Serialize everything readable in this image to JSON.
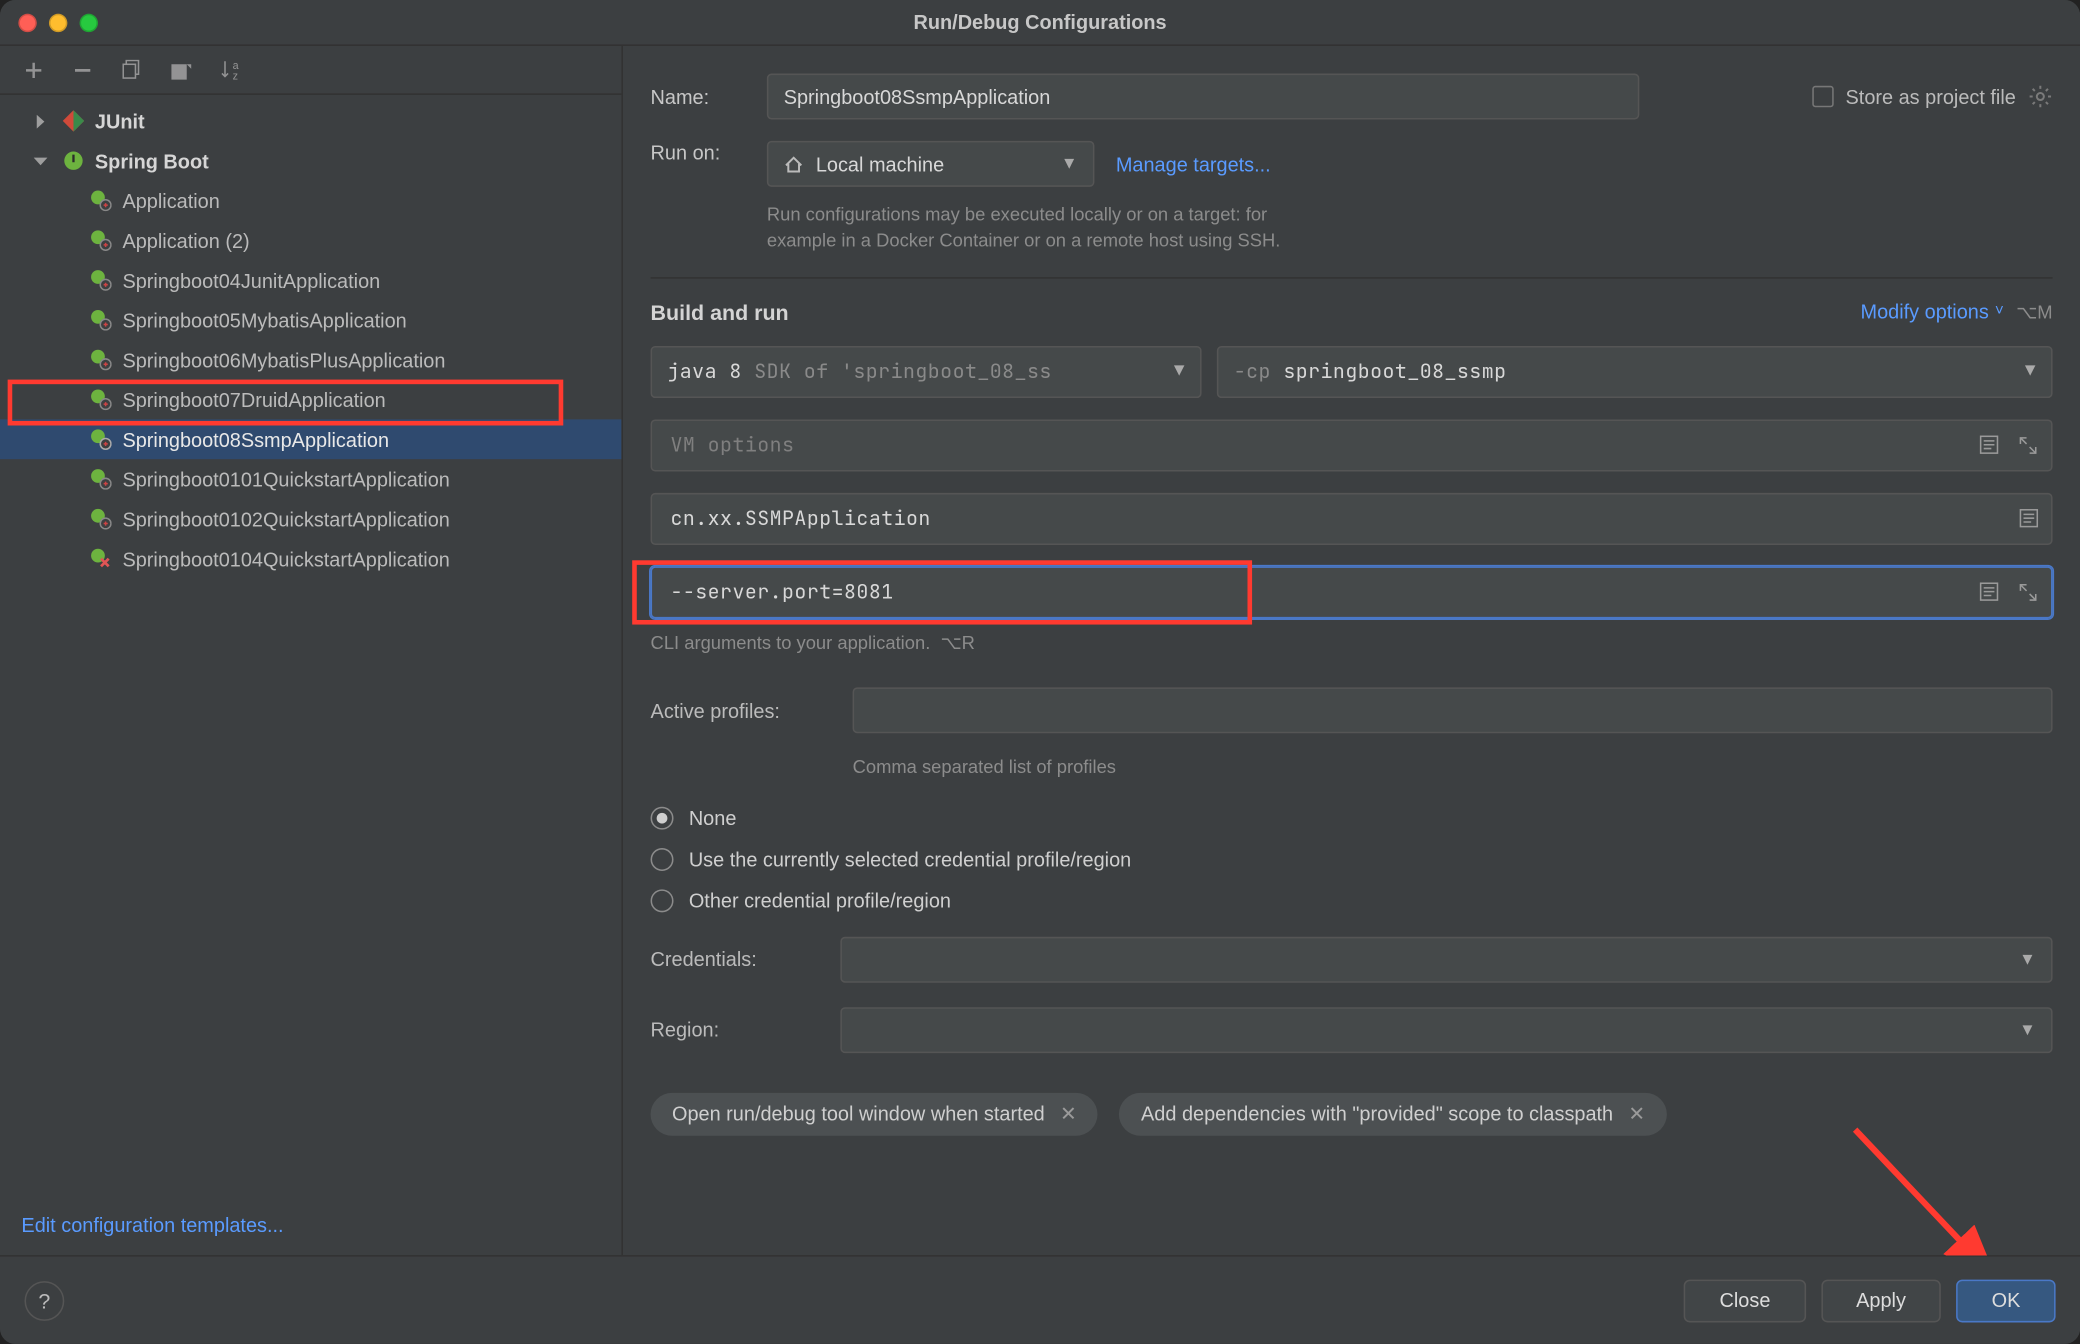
{
  "window": {
    "title": "Run/Debug Configurations"
  },
  "tree": {
    "junit_label": "JUnit",
    "spring_label": "Spring Boot",
    "items": [
      {
        "label": "Application"
      },
      {
        "label": "Application (2)"
      },
      {
        "label": "Springboot04JunitApplication"
      },
      {
        "label": "Springboot05MybatisApplication"
      },
      {
        "label": "Springboot06MybatisPlusApplication"
      },
      {
        "label": "Springboot07DruidApplication"
      },
      {
        "label": "Springboot08SsmpApplication",
        "selected": true
      },
      {
        "label": "Springboot0101QuickstartApplication"
      },
      {
        "label": "Springboot0102QuickstartApplication"
      },
      {
        "label": "Springboot0104QuickstartApplication",
        "error": true
      }
    ],
    "edit_templates": "Edit configuration templates..."
  },
  "form": {
    "name_label": "Name:",
    "name_value": "Springboot08SsmpApplication",
    "store_label": "Store as project file",
    "run_on_label": "Run on:",
    "run_on_value": "Local machine",
    "manage_targets": "Manage targets...",
    "run_on_help1": "Run configurations may be executed locally or on a target: for",
    "run_on_help2": "example in a Docker Container or on a remote host using SSH.",
    "section_title": "Build and run",
    "modify_options": "Modify options",
    "modify_shortcut": "⌥M",
    "sdk_prefix": "java 8",
    "sdk_suffix": "SDK of 'springboot_08_ss",
    "cp_prefix": "-cp",
    "cp_value": "springboot_08_ssmp",
    "vm_placeholder": "VM options",
    "main_class": "cn.xx.SSMPApplication",
    "cli_args": "--server.port=8081",
    "cli_help": "CLI arguments to your application.",
    "cli_help_shortcut": "⌥R",
    "active_profiles_label": "Active profiles:",
    "active_profiles_help": "Comma separated list of profiles",
    "radio_none": "None",
    "radio_cur": "Use the currently selected credential profile/region",
    "radio_other": "Other credential profile/region",
    "credentials_label": "Credentials:",
    "region_label": "Region:",
    "pill1": "Open run/debug tool window when started",
    "pill2": "Add dependencies with \"provided\" scope to classpath"
  },
  "footer": {
    "close": "Close",
    "apply": "Apply",
    "ok": "OK"
  }
}
